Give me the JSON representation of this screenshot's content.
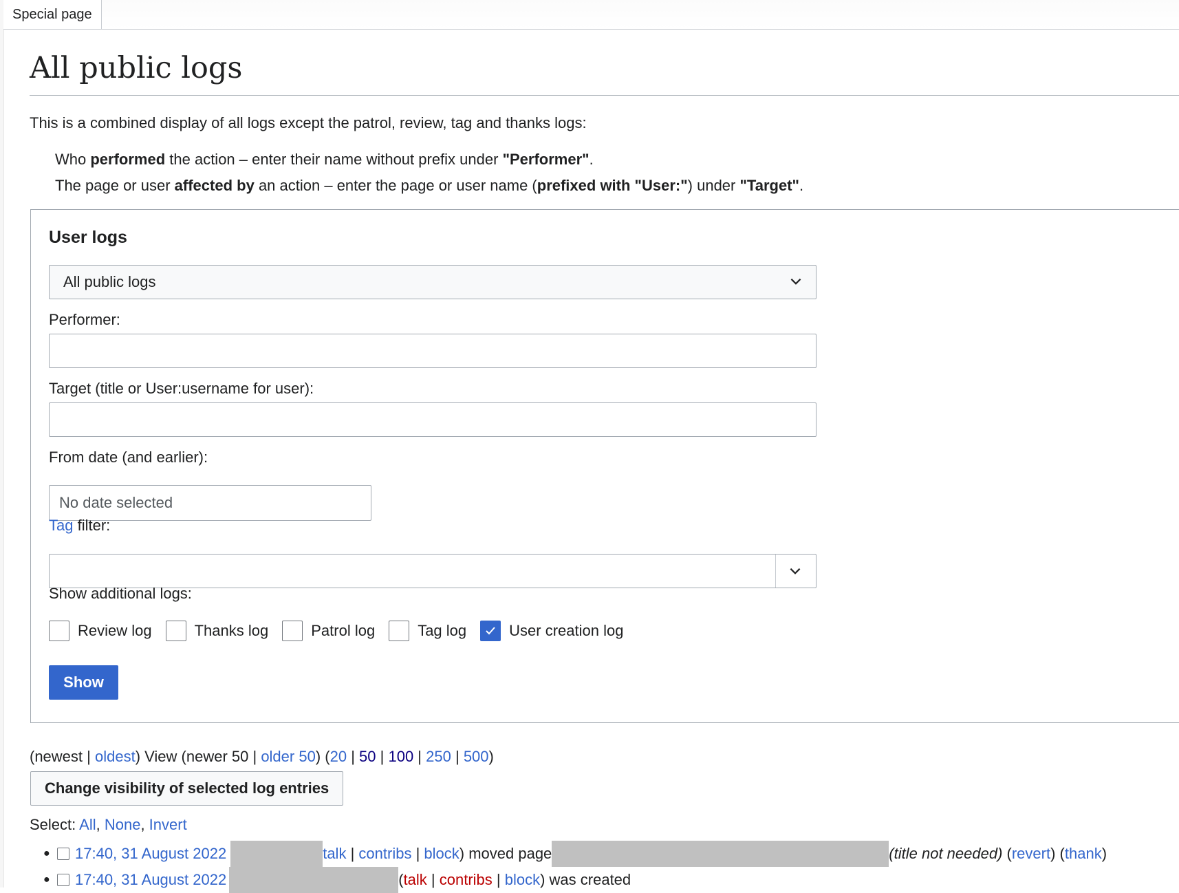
{
  "tabs": {
    "special_page": "Special page"
  },
  "page_title": "All public logs",
  "intro": {
    "text": "This is a combined display of all logs except the patrol, review, tag and thanks logs:",
    "item1": {
      "a": "Who ",
      "b": "performed",
      "c": " the action – enter their name without prefix under ",
      "d": "\"Performer\"",
      "e": "."
    },
    "item2": {
      "a": "The page or user ",
      "b": "affected by",
      "c": " an action – enter the page or user name (",
      "d": "prefixed with \"User:\"",
      "e": ") under ",
      "f": "\"Target\"",
      "g": "."
    }
  },
  "form": {
    "legend": "User logs",
    "log_type_selected": "All public logs",
    "performer_label": "Performer:",
    "performer_value": "",
    "target_label": "Target (title or User:username for user):",
    "target_value": "",
    "date_label": "From date (and earlier):",
    "date_placeholder": "No date selected",
    "tag_link": "Tag",
    "tag_label_rest": " filter:",
    "additional_label": "Show additional logs:",
    "checkboxes": [
      {
        "label": "Review log",
        "checked": false
      },
      {
        "label": "Thanks log",
        "checked": false
      },
      {
        "label": "Patrol log",
        "checked": false
      },
      {
        "label": "Tag log",
        "checked": false
      },
      {
        "label": "User creation log",
        "checked": true
      }
    ],
    "show_button": "Show"
  },
  "nav": {
    "p1": "(newest | ",
    "oldest": "oldest",
    "p2": ") View (newer 50 | ",
    "older50": "older 50",
    "p3": ") (",
    "n20": "20",
    "n50": "50",
    "n100": "100",
    "n250": "250",
    "n500": "500",
    "sep": " | ",
    "close": ")"
  },
  "visibility_button": "Change visibility of selected log entries",
  "select": {
    "label": "Select: ",
    "all": "All",
    "none": "None",
    "invert": "Invert",
    "comma": ", "
  },
  "entries": [
    {
      "time": "17:40, 31 August 2022",
      "talk": "talk",
      "contribs": "contribs",
      "block": "block",
      "action": ") moved page",
      "comment": "(title not needed)",
      "revert": "revert",
      "thank": "thank"
    },
    {
      "time": "17:40, 31 August 2022",
      "talk": "talk",
      "contribs": "contribs",
      "block": "block",
      "action": ") was created"
    }
  ]
}
